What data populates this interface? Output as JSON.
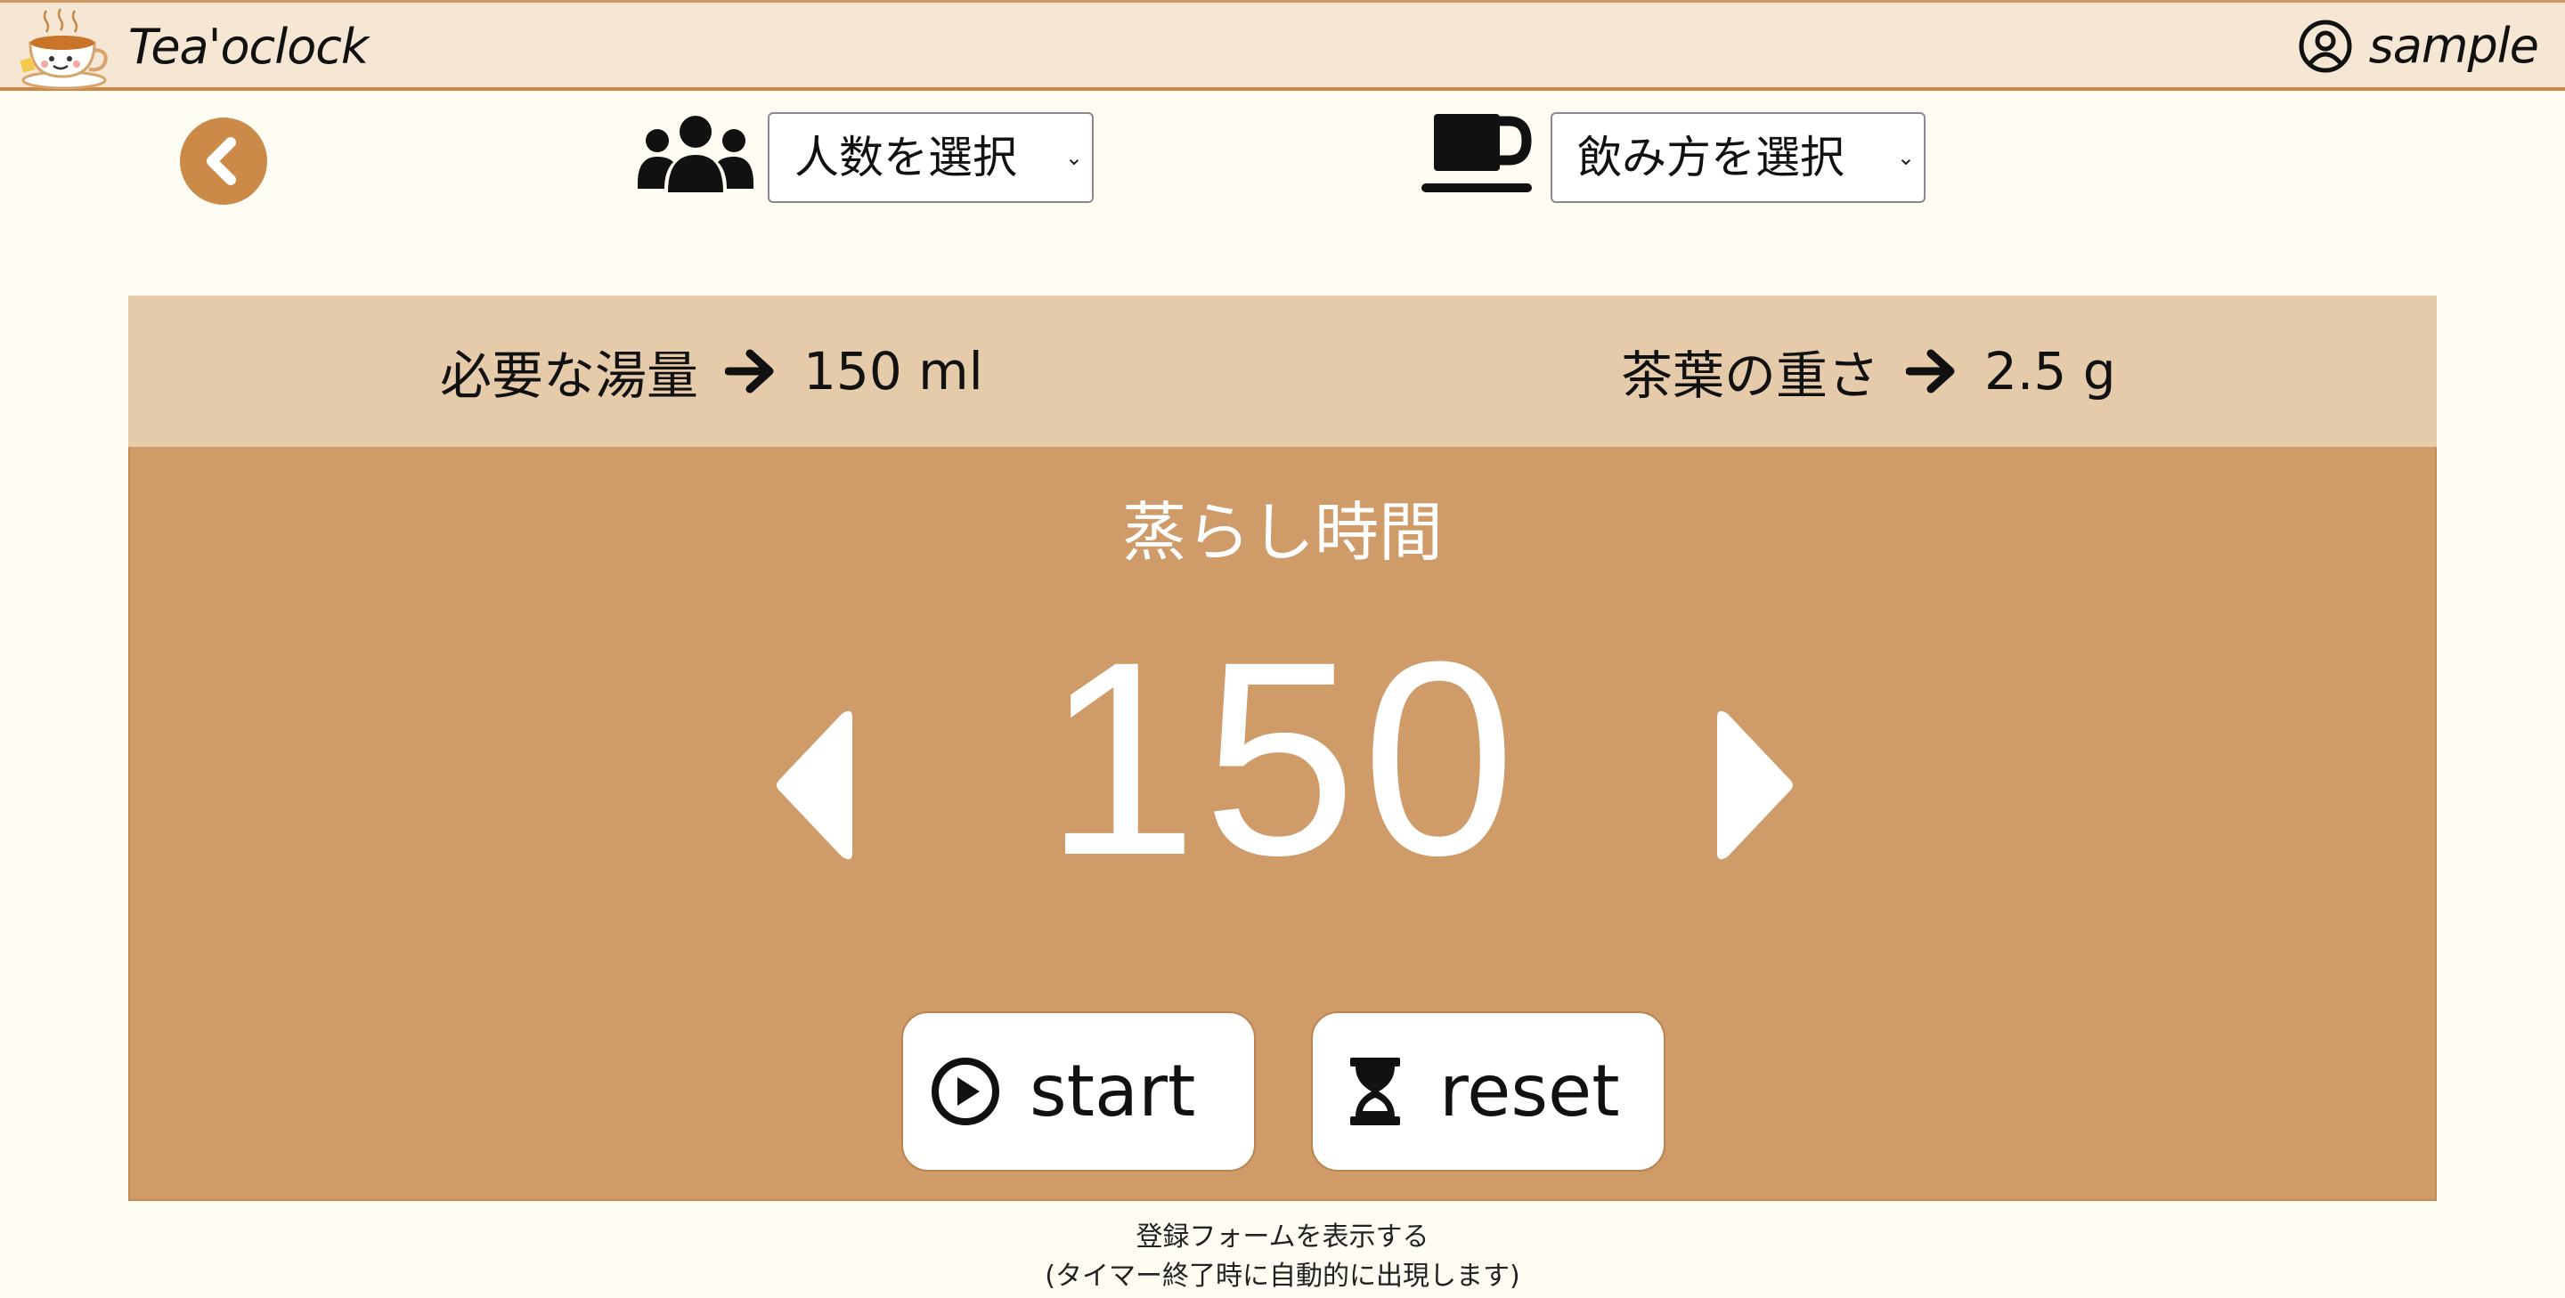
{
  "header": {
    "app_title": "Tea'oclock",
    "user_name": "sample",
    "logo_icon": "teacup-logo-icon",
    "user_icon": "user-circle-icon"
  },
  "controls": {
    "back_icon": "chevron-left-icon",
    "people_icon": "users-icon",
    "people_select": "人数を選択",
    "style_icon": "coffee-cup-icon",
    "style_select": "飲み方を選択"
  },
  "info": {
    "water_label": "必要な湯量",
    "water_value": "150 ml",
    "leaf_label": "茶葉の重さ",
    "leaf_value": "2.5 g",
    "arrow_icon": "arrow-right-icon"
  },
  "timer": {
    "label": "蒸らし時間",
    "value": "150",
    "decrease_icon": "caret-left-icon",
    "increase_icon": "caret-right-icon",
    "start_label": "start",
    "start_icon": "play-circle-icon",
    "reset_label": "reset",
    "reset_icon": "hourglass-icon"
  },
  "footer": {
    "form_link": "登録フォームを表示する",
    "form_note": "(タイマー終了時に自動的に出現します)"
  },
  "colors": {
    "background": "#fffdf3",
    "header_bg": "#f6e7d5",
    "header_border": "#c98845",
    "accent": "#cb8a47",
    "info_band": "#e6cbab",
    "timer_panel": "#cf9c69"
  }
}
